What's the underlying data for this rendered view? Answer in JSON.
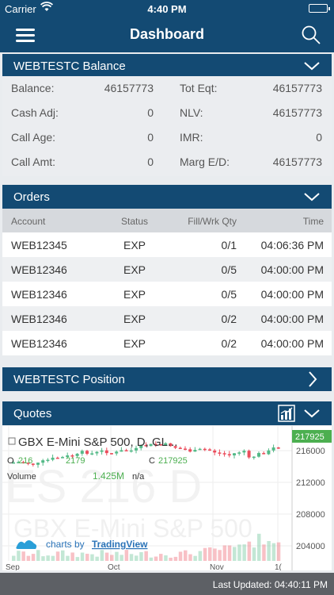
{
  "status_bar": {
    "carrier": "Carrier",
    "time": "4:40 PM"
  },
  "nav": {
    "title": "Dashboard"
  },
  "balance": {
    "header": "WEBTESTC Balance",
    "rows": [
      {
        "k1": "Balance:",
        "v1": "46157773",
        "k2": "Tot Eqt:",
        "v2": "46157773"
      },
      {
        "k1": "Cash Adj:",
        "v1": "0",
        "k2": "NLV:",
        "v2": "46157773"
      },
      {
        "k1": "Call Age:",
        "v1": "0",
        "k2": "IMR:",
        "v2": "0"
      },
      {
        "k1": "Call Amt:",
        "v1": "0",
        "k2": "Marg E/D:",
        "v2": "46157773"
      }
    ]
  },
  "orders": {
    "header": "Orders",
    "columns": {
      "account": "Account",
      "status": "Status",
      "fill": "Fill/Wrk Qty",
      "time": "Time"
    },
    "rows": [
      {
        "account": "WEB12345",
        "status": "EXP",
        "fill": "0/1",
        "time": "04:06:36 PM"
      },
      {
        "account": "WEB12346",
        "status": "EXP",
        "fill": "0/5",
        "time": "04:00:00 PM"
      },
      {
        "account": "WEB12346",
        "status": "EXP",
        "fill": "0/5",
        "time": "04:00:00 PM"
      },
      {
        "account": "WEB12346",
        "status": "EXP",
        "fill": "0/2",
        "time": "04:00:00 PM"
      },
      {
        "account": "WEB12346",
        "status": "EXP",
        "fill": "0/2",
        "time": "04:00:00 PM"
      }
    ]
  },
  "position": {
    "header": "WEBTESTC Position"
  },
  "quotes": {
    "header": "Quotes",
    "chart": {
      "symbol_title": "GBX E-Mini S&P 500, D, GL...",
      "ohlc_prefix_o": "O",
      "o_value": "216",
      "h_value": "2179",
      "c_label": "C",
      "c_value": "217925",
      "volume_label": "Volume",
      "volume_value": "1.425M",
      "volume_na": "n/a",
      "last_price": "217925",
      "y_ticks": [
        "216000",
        "212000",
        "208000",
        "204000"
      ],
      "x_ticks": [
        "Sep",
        "Oct",
        "Nov",
        "1("
      ],
      "watermark_symbol": "ES 216 D",
      "watermark_name": "GBX E-Mini S&P 500",
      "branding_prefix": "charts by",
      "branding_name": "TradingView",
      "colors": {
        "up": "#53b987",
        "down": "#eb4d5c",
        "last": "#4caf50"
      }
    }
  },
  "footer": {
    "last_updated": "Last Updated: 04:40:11 PM"
  }
}
